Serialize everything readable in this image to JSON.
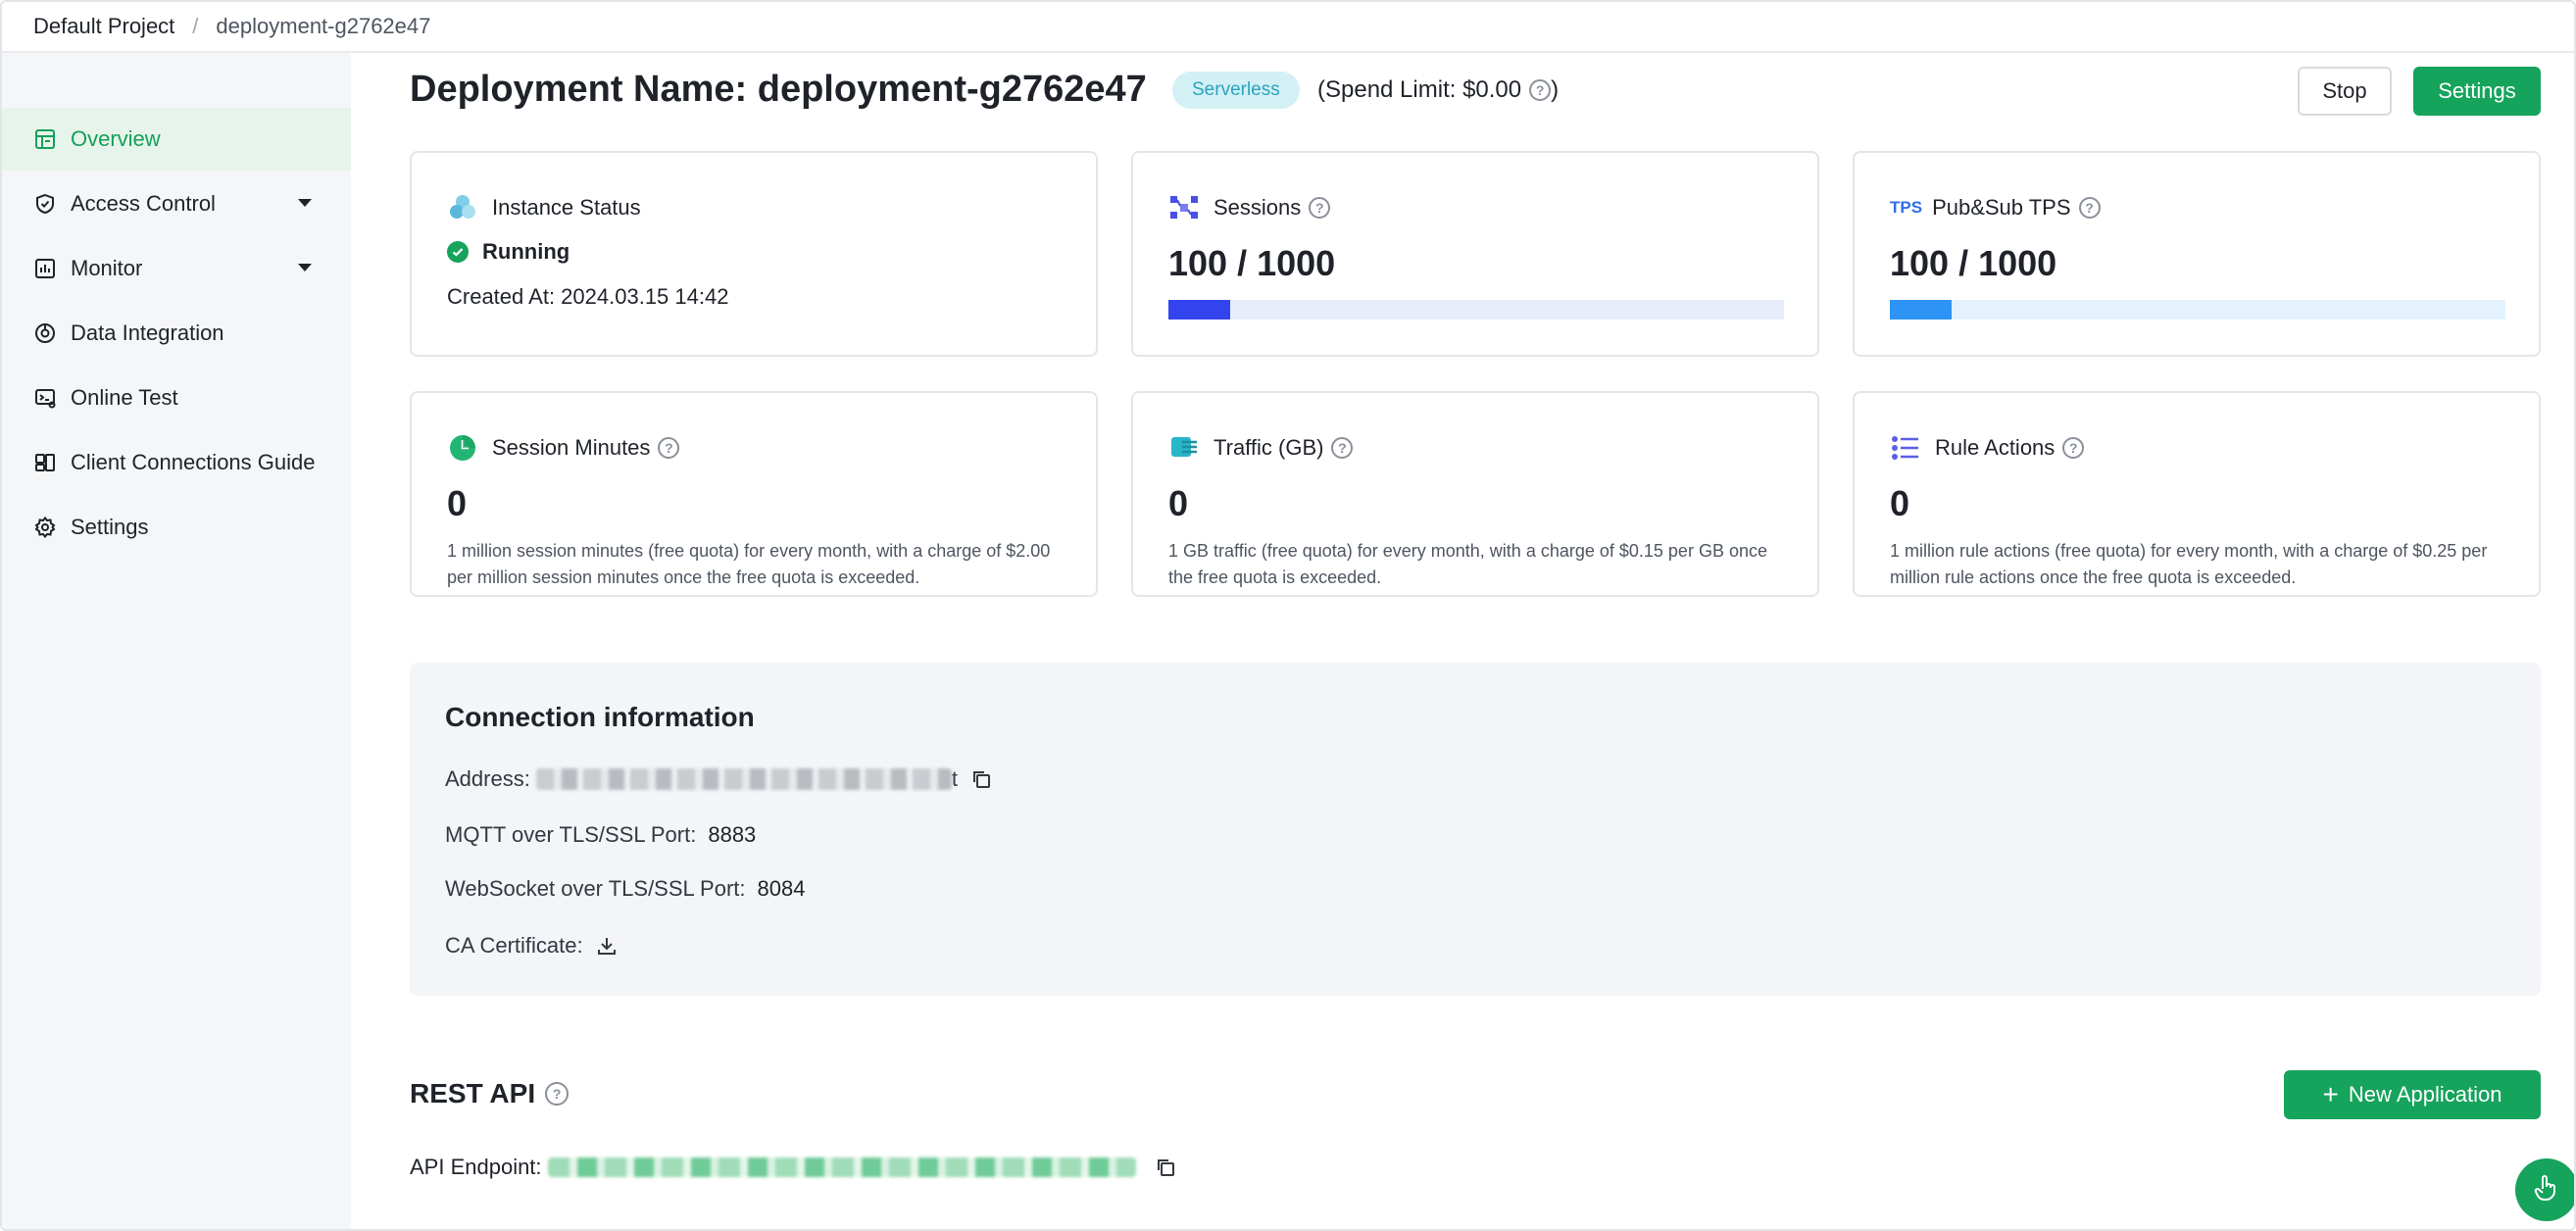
{
  "breadcrumb": {
    "project": "Default Project",
    "separator": "/",
    "deployment": "deployment-g2762e47"
  },
  "sidebar": {
    "items": [
      {
        "label": "Overview",
        "icon": "dashboard-icon",
        "active": true
      },
      {
        "label": "Access Control",
        "icon": "shield-check-icon"
      },
      {
        "label": "Monitor",
        "icon": "bar-chart-icon"
      },
      {
        "label": "Data Integration",
        "icon": "integration-icon"
      },
      {
        "label": "Online Test",
        "icon": "terminal-icon"
      },
      {
        "label": "Client Connections Guide",
        "icon": "guide-icon"
      },
      {
        "label": "Settings",
        "icon": "gear-icon"
      }
    ]
  },
  "header": {
    "title": "Deployment Name: deployment-g2762e47",
    "badge": "Serverless",
    "spend_limit": "(Spend Limit: $0.00",
    "spend_close": ")",
    "stop_label": "Stop",
    "settings_label": "Settings"
  },
  "cards": {
    "instance": {
      "label": "Instance Status",
      "status": "Running",
      "created": "Created At: 2024.03.15 14:42"
    },
    "sessions": {
      "label": "Sessions",
      "value": "100 / 1000",
      "progress": 0.1,
      "color": "#3344ee",
      "track": "#e8edfc"
    },
    "tps": {
      "label": "Pub&Sub TPS",
      "icon_text": "TPS",
      "value": "100 / 1000",
      "progress": 0.1,
      "color": "#2d93f5",
      "track": "#e3f2fd"
    },
    "minutes": {
      "label": "Session Minutes",
      "value": "0",
      "desc": "1 million session minutes (free quota) for every month, with a charge of $2.00 per million session minutes once the free quota is exceeded."
    },
    "traffic": {
      "label": "Traffic (GB)",
      "value": "0",
      "desc": "1 GB traffic (free quota) for every month, with a charge of $0.15 per GB once the free quota is exceeded."
    },
    "rules": {
      "label": "Rule Actions",
      "value": "0",
      "desc": "1 million rule actions (free quota) for every month, with a charge of $0.25 per million rule actions once the free quota is exceeded."
    }
  },
  "connection": {
    "title": "Connection information",
    "address_label": "Address:",
    "address_tail": "t",
    "mqtt_label": "MQTT over TLS/SSL Port:",
    "mqtt_port": "8883",
    "ws_label": "WebSocket over TLS/SSL Port:",
    "ws_port": "8084",
    "ca_label": "CA Certificate:"
  },
  "rest_api": {
    "title": "REST API",
    "new_app_label": "New Application",
    "endpoint_label": "API Endpoint:"
  },
  "colors": {
    "accent": "#16a35c",
    "badge_bg": "#d3f0f5",
    "badge_text": "#2aa4bf"
  }
}
